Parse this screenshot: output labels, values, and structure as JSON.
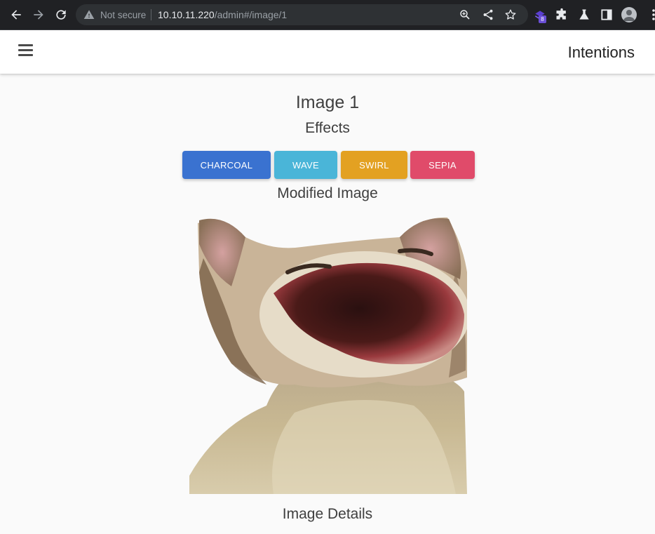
{
  "browser": {
    "not_secure_label": "Not secure",
    "url_host": "10.10.11.220",
    "url_path": "/admin#/image/1",
    "extension_badge": "8",
    "icons": [
      "back-icon",
      "forward-icon",
      "reload-icon",
      "warning-icon",
      "zoom-icon",
      "share-icon",
      "star-icon",
      "extension-icon",
      "puzzle-icon",
      "flask-icon",
      "sidebar-icon",
      "profile-icon",
      "more-icon"
    ]
  },
  "app": {
    "brand": "Intentions",
    "menu_icon": "hamburger-icon"
  },
  "page": {
    "title": "Image 1",
    "effects_heading": "Effects",
    "modified_heading": "Modified Image",
    "details_heading": "Image Details"
  },
  "effects": [
    {
      "label": "CHARCOAL",
      "color": "#3a72d0"
    },
    {
      "label": "WAVE",
      "color": "#4ab5d8"
    },
    {
      "label": "SWIRL",
      "color": "#e3a122"
    },
    {
      "label": "SEPIA",
      "color": "#e04b6a"
    }
  ]
}
